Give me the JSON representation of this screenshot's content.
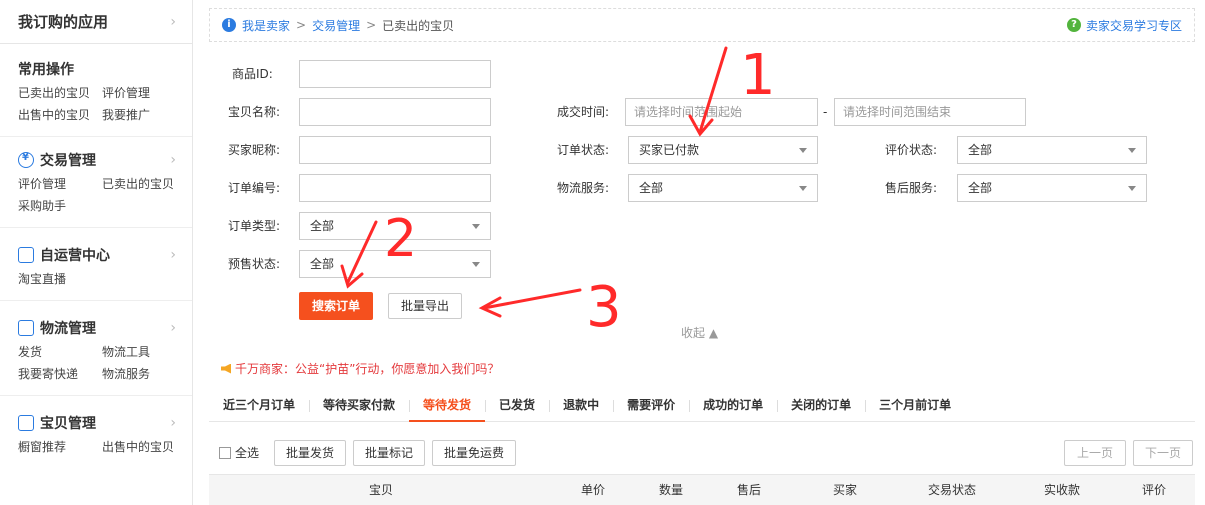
{
  "sidebar": {
    "header": "我订购的应用",
    "sections": [
      {
        "title": "常用操作",
        "icon": "",
        "links": [
          "已卖出的宝贝",
          "评价管理",
          "出售中的宝贝",
          "我要推广"
        ]
      },
      {
        "title": "交易管理",
        "icon": "currency-icon",
        "links": [
          "评价管理",
          "已卖出的宝贝",
          "采购助手"
        ]
      },
      {
        "title": "自运营中心",
        "icon": "chat-icon",
        "links": [
          "淘宝直播"
        ]
      },
      {
        "title": "物流管理",
        "icon": "truck-icon",
        "links": [
          "发货",
          "物流工具",
          "我要寄快递",
          "物流服务"
        ]
      },
      {
        "title": "宝贝管理",
        "icon": "bag-icon",
        "links": [
          "橱窗推荐",
          "出售中的宝贝"
        ]
      }
    ]
  },
  "breadcrumb": {
    "items": [
      "我是卖家",
      "交易管理",
      "已卖出的宝贝"
    ],
    "help_link": "卖家交易学习专区"
  },
  "form": {
    "product_id_label": "商品ID:",
    "item_name_label": "宝贝名称:",
    "buyer_nick_label": "买家昵称:",
    "order_no_label": "订单编号:",
    "order_type_label": "订单类型:",
    "order_type_value": "全部",
    "presale_label": "预售状态:",
    "presale_value": "全部",
    "deal_time_label": "成交时间:",
    "time_start_placeholder": "请选择时间范围起始",
    "time_sep": "-",
    "time_end_placeholder": "请选择时间范围结束",
    "order_status_label": "订单状态:",
    "order_status_value": "买家已付款",
    "logistics_label": "物流服务:",
    "logistics_value": "全部",
    "review_status_label": "评价状态:",
    "review_status_value": "全部",
    "aftersale_label": "售后服务:",
    "aftersale_value": "全部",
    "search_button": "搜索订单",
    "export_button": "批量导出",
    "collapse": "收起 ▲"
  },
  "notice": "千万商家：公益“护苗”行动，你愿意加入我们吗？",
  "tabs": [
    "近三个月订单",
    "等待买家付款",
    "等待发货",
    "已发货",
    "退款中",
    "需要评价",
    "成功的订单",
    "关闭的订单",
    "三个月前订单"
  ],
  "active_tab": "等待发货",
  "toolbar": {
    "select_all": "全选",
    "batch_ship": "批量发货",
    "batch_mark": "批量标记",
    "batch_free_ship": "批量免运费",
    "prev_page": "上一页",
    "next_page": "下一页"
  },
  "table_headers": [
    "宝贝",
    "单价",
    "数量",
    "售后",
    "买家",
    "交易状态",
    "实收款",
    "评价"
  ],
  "annotations": [
    "1",
    "2",
    "3"
  ],
  "colors": {
    "accent": "#f5501e",
    "link": "#2b7be0",
    "annotation": "#ff2a2a"
  }
}
